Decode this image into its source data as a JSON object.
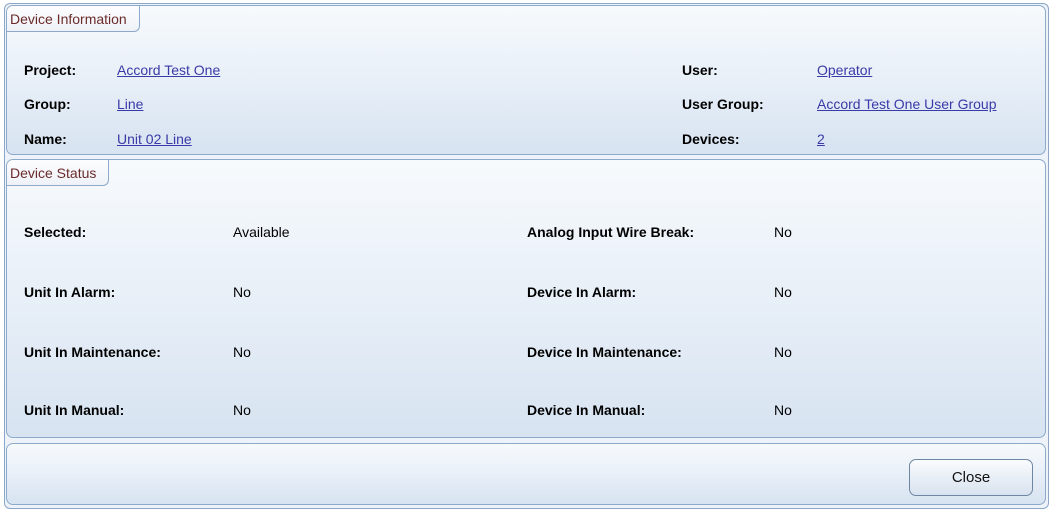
{
  "device_information": {
    "tab_label": "Device Information",
    "project": {
      "label": "Project:",
      "value": "Accord Test One"
    },
    "group": {
      "label": "Group:",
      "value": "Line"
    },
    "name": {
      "label": "Name:",
      "value": "Unit 02 Line"
    },
    "user": {
      "label": "User:",
      "value": "Operator"
    },
    "user_group": {
      "label": "User Group:",
      "value": "Accord Test One User Group"
    },
    "devices": {
      "label": "Devices:",
      "value": "2"
    }
  },
  "device_status": {
    "tab_label": "Device Status",
    "selected": {
      "label": "Selected:",
      "value": "Available"
    },
    "unit_in_alarm": {
      "label": "Unit In Alarm:",
      "value": "No"
    },
    "unit_in_maintenance": {
      "label": "Unit In Maintenance:",
      "value": "No"
    },
    "unit_in_manual": {
      "label": "Unit In Manual:",
      "value": "No"
    },
    "analog_input_wire_break": {
      "label": "Analog Input Wire Break:",
      "value": "No"
    },
    "device_in_alarm": {
      "label": "Device In Alarm:",
      "value": "No"
    },
    "device_in_maintenance": {
      "label": "Device In Maintenance:",
      "value": "No"
    },
    "device_in_manual": {
      "label": "Device In Manual:",
      "value": "No"
    }
  },
  "footer": {
    "close_label": "Close"
  }
}
